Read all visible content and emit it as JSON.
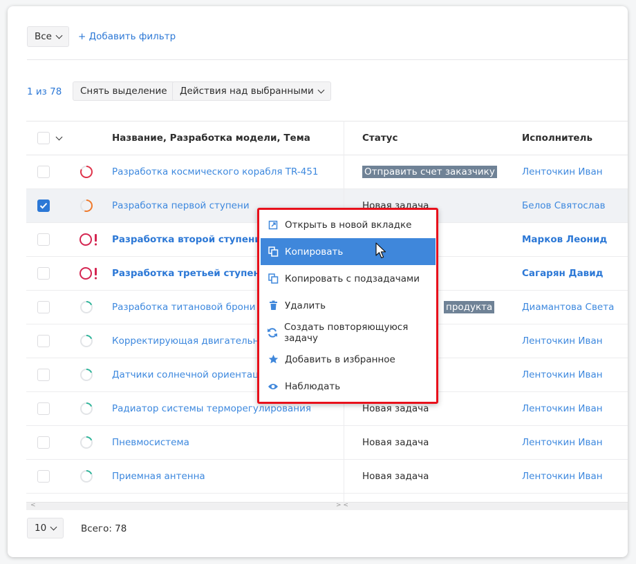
{
  "toolbar": {
    "filter_select": "Все",
    "add_filter": "+ Добавить фильтр"
  },
  "selection": {
    "count": "1 из 78",
    "deselect": "Снять выделение",
    "actions": "Действия над выбранными"
  },
  "table": {
    "headers": {
      "name": "Название, Разработка модели, Тема",
      "status": "Статус",
      "assignee": "Исполнитель"
    },
    "rows": [
      {
        "name": "Разработка космического корабля TR-451",
        "status": "Отправить счет заказчику",
        "assignee": "Ленточкин Иван",
        "checked": false,
        "bold": false,
        "icon": "progress-red-ring-icon",
        "icon_color": "#e0334a",
        "status_highlight": true
      },
      {
        "name": "Разработка первой ступени",
        "status": "Новая задача",
        "assignee": "Белов Святослав",
        "checked": true,
        "bold": false,
        "icon": "progress-orange-ring-icon",
        "icon_color": "#f07a2b",
        "status_highlight": false
      },
      {
        "name": "Разработка второй ступени",
        "status": "",
        "assignee": "Марков Леонид",
        "checked": false,
        "bold": true,
        "icon": "overdue-ring-icon",
        "icon_color": "#d42450",
        "status_highlight": false
      },
      {
        "name": "Разработка третьей ступени",
        "status": "",
        "assignee": "Сагарян Давид",
        "checked": false,
        "bold": true,
        "icon": "overdue-ring-icon",
        "icon_color": "#d42450",
        "status_highlight": false
      },
      {
        "name": "Разработка титановой брони РО",
        "status": "продукта",
        "assignee": "Диамантова Света",
        "checked": false,
        "bold": false,
        "icon": "progress-green-ring-icon",
        "icon_color": "#2fb59a",
        "status_highlight": true
      },
      {
        "name": "Корректирующая двигательная у",
        "status": "",
        "assignee": "Ленточкин Иван",
        "checked": false,
        "bold": false,
        "icon": "progress-green-ring-icon",
        "icon_color": "#2fb59a",
        "status_highlight": false
      },
      {
        "name": "Датчики солнечной ориентации",
        "status": "",
        "assignee": "Ленточкин Иван",
        "checked": false,
        "bold": false,
        "icon": "progress-green-ring-icon",
        "icon_color": "#2fb59a",
        "status_highlight": false
      },
      {
        "name": "Радиатор системы терморегулирования",
        "status": "Новая задача",
        "assignee": "Ленточкин Иван",
        "checked": false,
        "bold": false,
        "icon": "progress-green-ring-icon",
        "icon_color": "#2fb59a",
        "status_highlight": false
      },
      {
        "name": "Пневмосистема",
        "status": "Новая задача",
        "assignee": "Ленточкин Иван",
        "checked": false,
        "bold": false,
        "icon": "progress-green-ring-icon",
        "icon_color": "#2fb59a",
        "status_highlight": false
      },
      {
        "name": "Приемная антенна",
        "status": "Новая задача",
        "assignee": "Ленточкин Иван",
        "checked": false,
        "bold": false,
        "icon": "progress-green-ring-icon",
        "icon_color": "#2fb59a",
        "status_highlight": false
      }
    ]
  },
  "context_menu": {
    "items": [
      {
        "label": "Открыть в новой вкладке",
        "icon": "external-link-icon",
        "active": false
      },
      {
        "label": "Копировать",
        "icon": "copy-icon",
        "active": true
      },
      {
        "label": "Копировать с подзадачами",
        "icon": "copy-with-subtasks-icon",
        "active": false
      },
      {
        "label": "Удалить",
        "icon": "trash-icon",
        "active": false
      },
      {
        "label": "Создать повторяющуюся задачу",
        "icon": "repeat-icon",
        "active": false
      },
      {
        "label": "Добавить в избранное",
        "icon": "star-icon",
        "active": false
      },
      {
        "label": "Наблюдать",
        "icon": "eye-icon",
        "active": false
      }
    ]
  },
  "footer": {
    "page_size": "10",
    "total": "Всего: 78"
  },
  "scrollbar": {
    "left_arrow": "<",
    "middle_arrows": "> <"
  },
  "colors": {
    "accent": "#2c78d6",
    "menu_border": "#e8101b",
    "menu_active": "#3f87db",
    "status_highlight": "#6f8296"
  }
}
